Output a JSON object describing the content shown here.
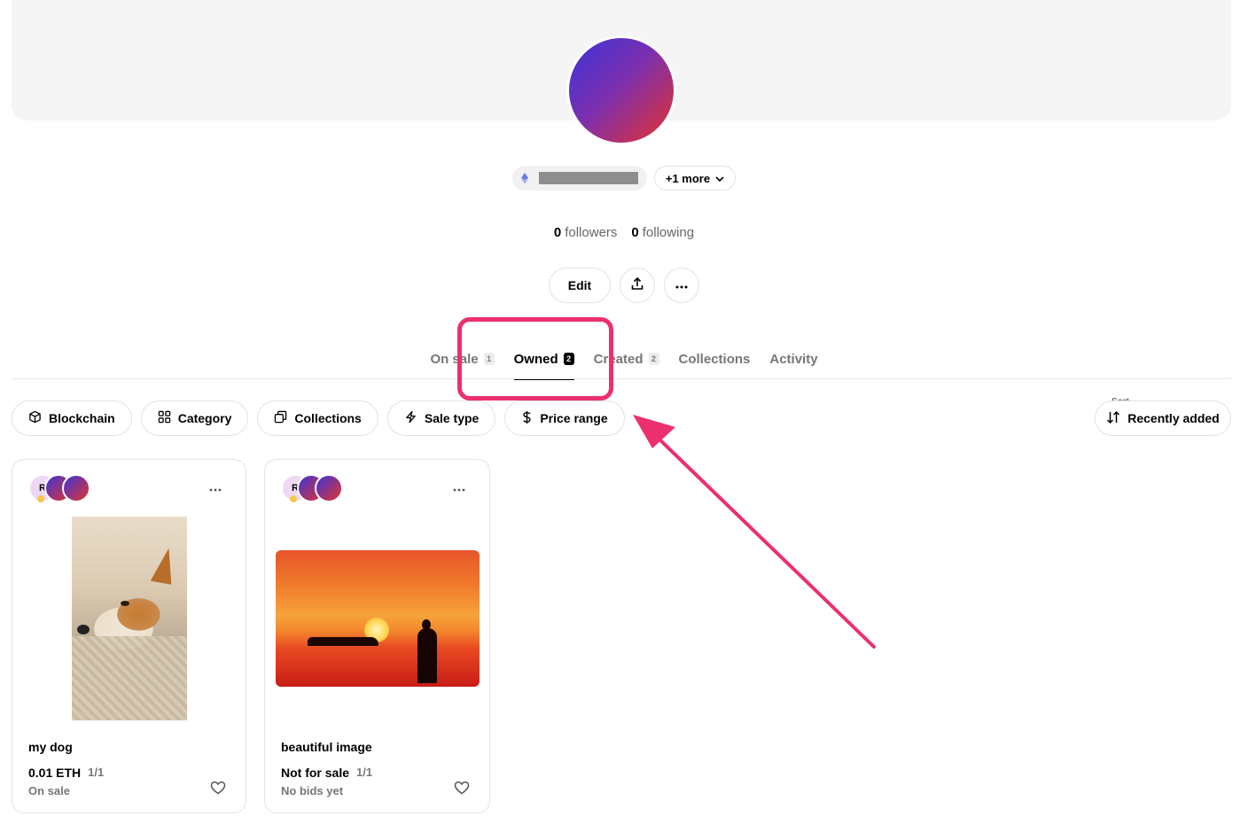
{
  "profile": {
    "more_label": "+1 more",
    "followers_count": "0",
    "followers_label": "followers",
    "following_count": "0",
    "following_label": "following",
    "edit_label": "Edit"
  },
  "tabs": [
    {
      "label": "On sale",
      "count": "1"
    },
    {
      "label": "Owned",
      "count": "2"
    },
    {
      "label": "Created",
      "count": "2"
    },
    {
      "label": "Collections"
    },
    {
      "label": "Activity"
    }
  ],
  "filters": {
    "blockchain": "Blockchain",
    "category": "Category",
    "collections": "Collections",
    "sale_type": "Sale type",
    "price_range": "Price range"
  },
  "sort": {
    "label": "Sort",
    "value": "Recently added"
  },
  "cards": [
    {
      "title": "my dog",
      "price": "0.01 ETH",
      "edition": "1/1",
      "status": "On sale",
      "avatar_letter": "R"
    },
    {
      "title": "beautiful image",
      "price": "Not for sale",
      "edition": "1/1",
      "status": "No bids yet",
      "avatar_letter": "R"
    }
  ],
  "colors": {
    "annotation": "#ec2f6e",
    "gradient_start": "#3a35d9",
    "gradient_end": "#e5322e"
  }
}
